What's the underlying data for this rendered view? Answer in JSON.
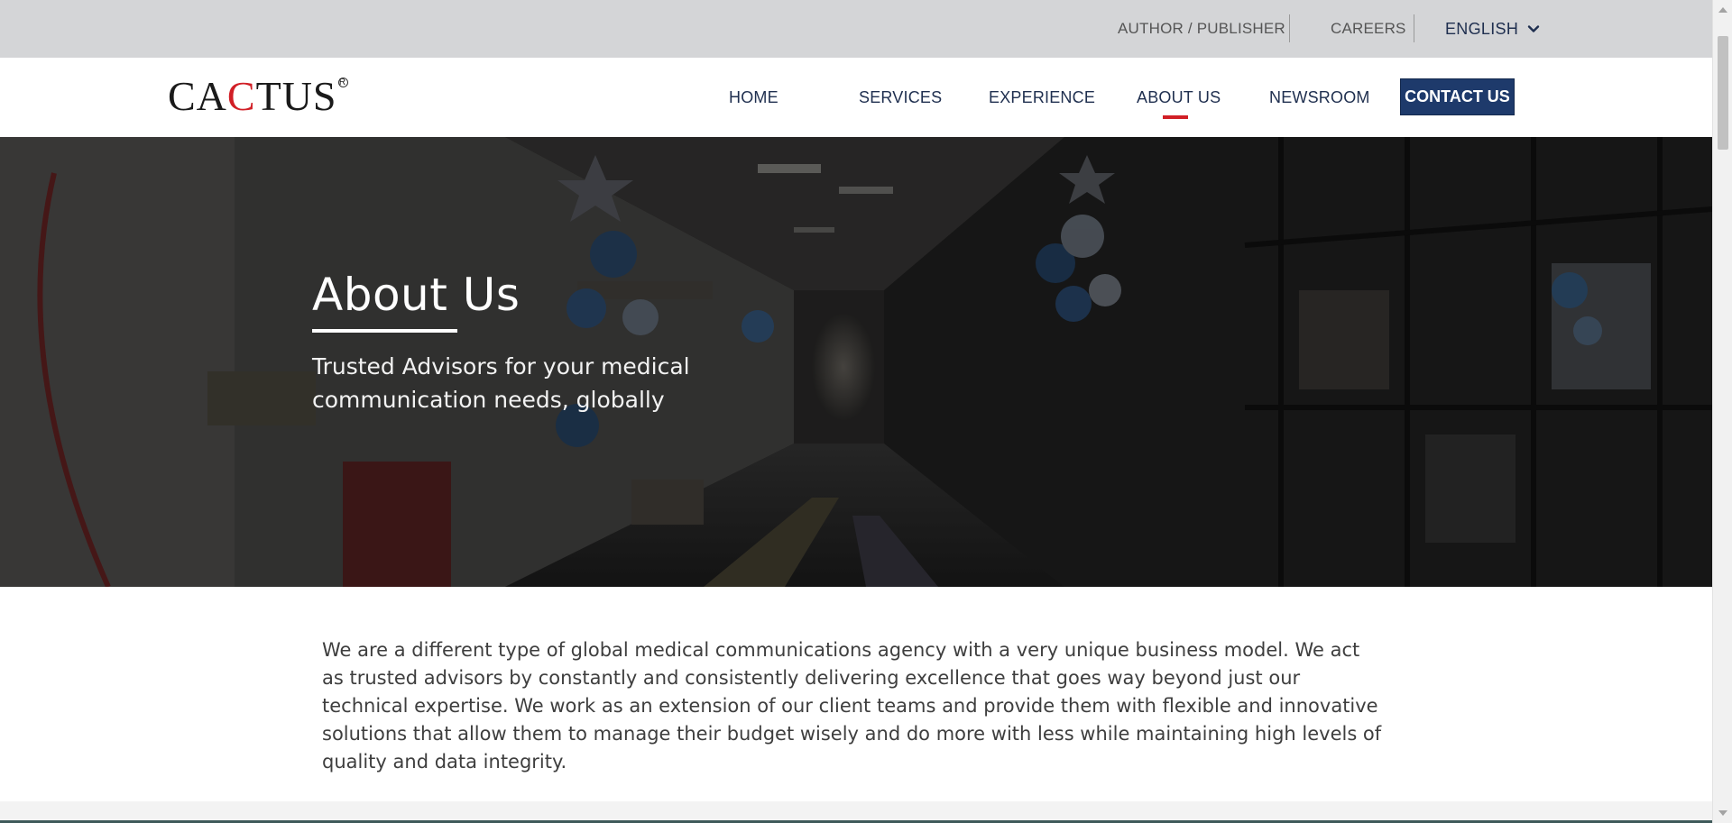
{
  "top_bar": {
    "author_publisher": "AUTHOR / PUBLISHER",
    "careers": "CAREERS",
    "language": "ENGLISH",
    "language_icon": "chevron-down-icon"
  },
  "header": {
    "logo": {
      "part1": "CA",
      "part2": "C",
      "part3": "TUS",
      "registered": "R"
    },
    "nav": [
      {
        "label": "HOME"
      },
      {
        "label": "SERVICES"
      },
      {
        "label": "EXPERIENCE"
      },
      {
        "label": "ABOUT US",
        "active": true
      },
      {
        "label": "NEWSROOM"
      }
    ],
    "contact": "CONTACT US"
  },
  "hero": {
    "title": "About Us",
    "subtitle": "Trusted Advisors for your medical communication needs, globally"
  },
  "intro": {
    "text": "We are a different type of global medical communications agency with a very unique business model. We act as trusted advisors by constantly and consistently delivering excellence that goes way beyond just our technical expertise. We work as an extension of our client teams and provide them with flexible and innovative solutions that allow them to manage their budget wisely and do more with less while maintaining high levels of quality and data integrity."
  },
  "colors": {
    "brand_navy": "#1e3a6b",
    "brand_red": "#d11f26",
    "top_bar_bg": "#d4d5d7"
  }
}
